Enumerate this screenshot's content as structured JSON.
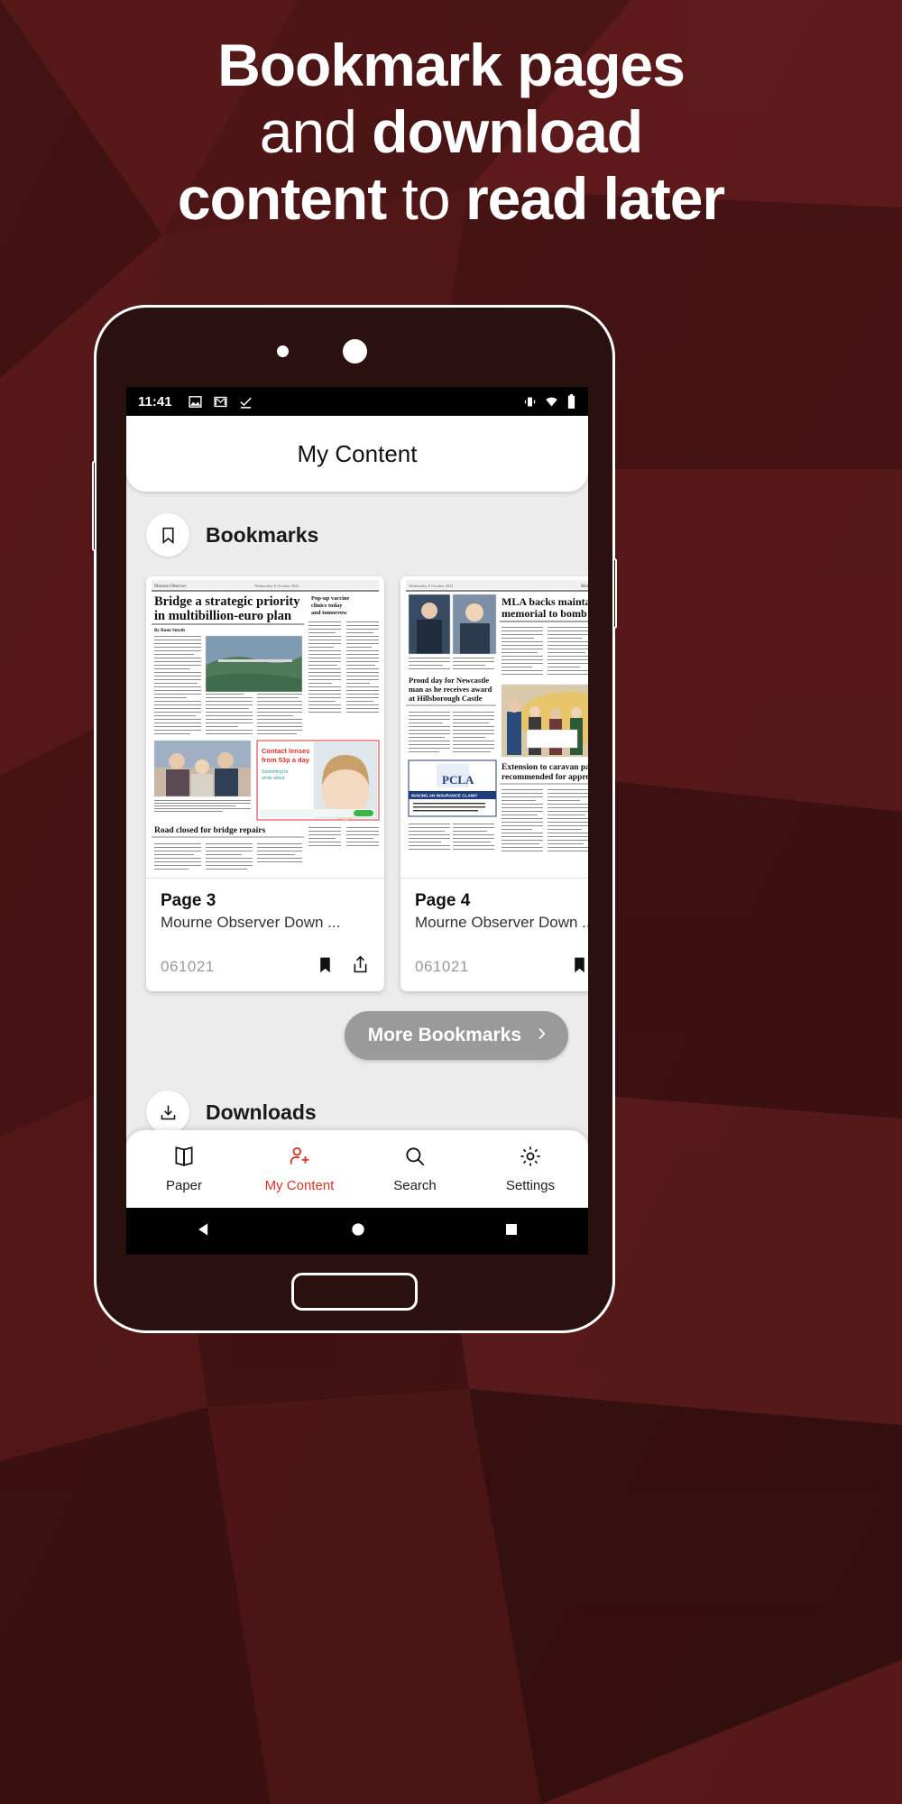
{
  "promo": {
    "headline_lines": [
      [
        {
          "t": "Bookmark pages",
          "w": "bold"
        }
      ],
      [
        {
          "t": "and ",
          "w": "light"
        },
        {
          "t": "download",
          "w": "bold"
        }
      ],
      [
        {
          "t": "content ",
          "w": "bold"
        },
        {
          "t": "to ",
          "w": "light"
        },
        {
          "t": "read later",
          "w": "bold"
        }
      ]
    ],
    "background_color": "#4a1414"
  },
  "device": {
    "frame_color": "#ffffff",
    "status_bar": {
      "time": "11:41",
      "left_icons": [
        "image-icon",
        "gmail-icon",
        "task-check-icon"
      ],
      "right_icons": [
        "vibrate-icon",
        "wifi-icon",
        "battery-icon"
      ]
    },
    "android_nav": [
      "back-triangle",
      "home-circle",
      "recents-square"
    ]
  },
  "app": {
    "appbar": {
      "title": "My Content"
    },
    "sections": [
      {
        "id": "bookmarks",
        "icon": "bookmark-outline-icon",
        "title": "Bookmarks"
      },
      {
        "id": "downloads",
        "icon": "download-icon",
        "title": "Downloads"
      }
    ],
    "bookmark_cards": [
      {
        "title": "Page 3",
        "subtitle": "Mourne Observer Down ...",
        "date": "061021",
        "actions": [
          "bookmark-filled-icon",
          "share-icon"
        ],
        "thumb_masthead": "Mourne Observer",
        "thumb_date": "Wednesday 6 October 2021",
        "thumb_headlines": [
          "Bridge a strategic priority in multibillion-euro plan",
          "Pop-up vaccine clinics today and tomorrow",
          "Contact lenses from 53p a day",
          "Something to smile about",
          "Road closed for bridge repairs"
        ],
        "thumb_byline": "By Rosie Smyth"
      },
      {
        "title": "Page 4",
        "subtitle": "Mourne Observer Down ...",
        "date": "061021",
        "actions": [
          "bookmark-filled-icon",
          "share-icon"
        ],
        "thumb_masthead": "Mourne Observer",
        "thumb_date": "Wednesday 6 October 2021",
        "thumb_headlines": [
          "MLA backs maintaining memorial to bomb victim",
          "Proud day for Newcastle man as he receives award at Hillsborough Castle",
          "MAKING AN INSURANCE CLAIM?",
          "PCLA",
          "Extension to caravan park recommended for approval"
        ],
        "thumb_byline": ""
      }
    ],
    "more_button": {
      "label": "More Bookmarks",
      "icon": "chevron-right-icon",
      "color": "#9a9a9a"
    },
    "bottom_nav": {
      "active_color": "#e03127",
      "items": [
        {
          "id": "paper",
          "label": "Paper",
          "icon": "paper-book-icon",
          "active": false
        },
        {
          "id": "my-content",
          "label": "My Content",
          "icon": "person-add-icon",
          "active": true
        },
        {
          "id": "search",
          "label": "Search",
          "icon": "search-icon",
          "active": false
        },
        {
          "id": "settings",
          "label": "Settings",
          "icon": "gear-icon",
          "active": false
        }
      ]
    }
  }
}
